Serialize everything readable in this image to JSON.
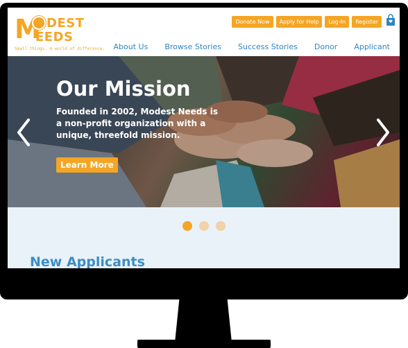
{
  "logo": {
    "line1_letter": "M",
    "line1_rest": "DEST",
    "line2_rest": "EEDS",
    "tagline": "Small things. A world of difference."
  },
  "top_buttons": [
    "Donate Now",
    "Apply for Help",
    "Log-In",
    "Register"
  ],
  "nav": [
    "About Us",
    "Browse Stories",
    "Success Stories",
    "Donor",
    "Applicant"
  ],
  "hero": {
    "title": "Our Mission",
    "text": "Founded in 2002, Modest Needs is a non-profit organization with a unique, threefold mission.",
    "button": "Learn More"
  },
  "carousel": {
    "slides": 3,
    "active": 1
  },
  "section_title": "New Applicants",
  "colors": {
    "accent": "#f5a524",
    "link": "#2e86c1",
    "band": "#e8f2f8"
  },
  "icons": {
    "prev": "chevron-left-icon",
    "next": "chevron-right-icon",
    "cart": "shopping-bag-icon"
  }
}
